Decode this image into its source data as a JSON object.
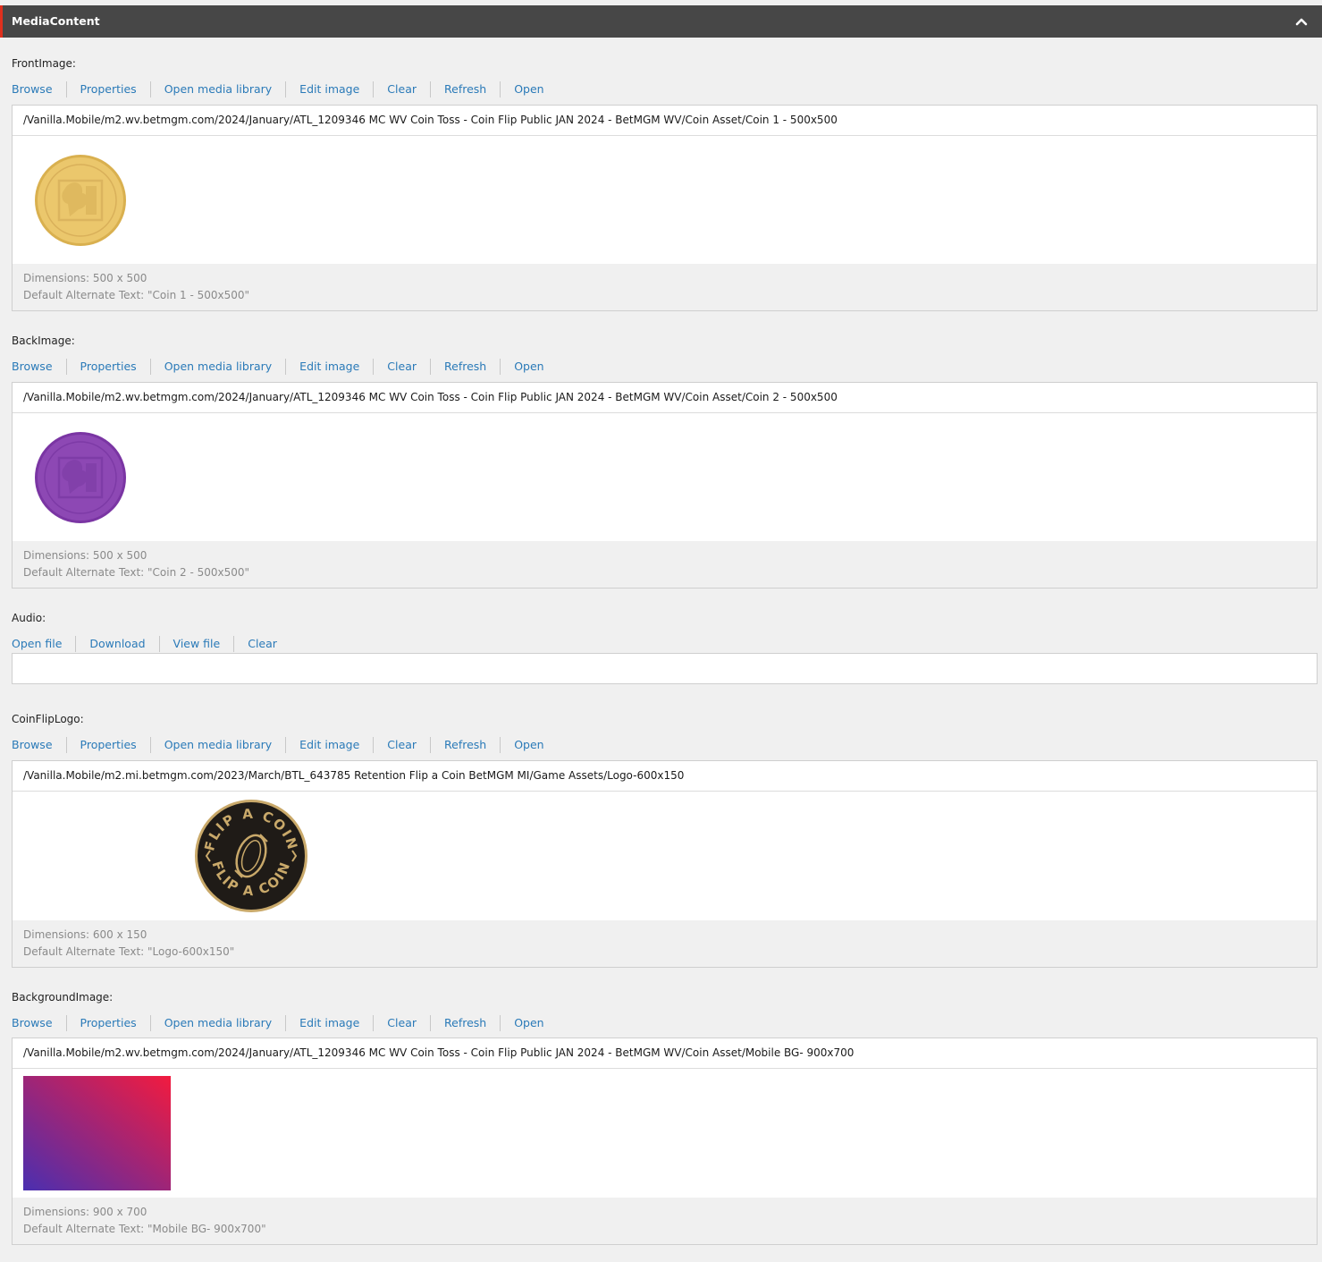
{
  "header": {
    "title": "MediaContent",
    "collapse_icon": "chevron-up-icon"
  },
  "image_actions": [
    "Browse",
    "Properties",
    "Open media library",
    "Edit image",
    "Clear",
    "Refresh",
    "Open"
  ],
  "audio_actions": [
    "Open file",
    "Download",
    "View file",
    "Clear"
  ],
  "front_image": {
    "label": "FrontImage:",
    "path": "/Vanilla.Mobile/m2.wv.betmgm.com/2024/January/ATL_1209346 MC WV Coin Toss - Coin Flip Public JAN 2024 - BetMGM WV/Coin Asset/Coin 1 - 500x500",
    "dimensions": "Dimensions: 500 x 500",
    "alt_text": "Default Alternate Text: \"Coin 1 - 500x500\"",
    "thumbnail": "gold-coin-image",
    "color": "#e8c46a"
  },
  "back_image": {
    "label": "BackImage:",
    "path": "/Vanilla.Mobile/m2.wv.betmgm.com/2024/January/ATL_1209346 MC WV Coin Toss - Coin Flip Public JAN 2024 - BetMGM WV/Coin Asset/Coin 2 - 500x500",
    "dimensions": "Dimensions: 500 x 500",
    "alt_text": "Default Alternate Text: \"Coin 2 - 500x500\"",
    "thumbnail": "purple-coin-image",
    "color": "#8a45b0"
  },
  "audio": {
    "label": "Audio:",
    "value": ""
  },
  "coin_flip_logo": {
    "label": "CoinFlipLogo:",
    "path": "/Vanilla.Mobile/m2.mi.betmgm.com/2023/March/BTL_643785 Retention Flip a Coin BetMGM MI/Game Assets/Logo-600x150",
    "dimensions": "Dimensions: 600 x 150",
    "alt_text": "Default Alternate Text: \"Logo-600x150\"",
    "thumbnail": "flip-a-coin-logo",
    "logo_text": "FLIP A COIN",
    "color": "#c9a96a"
  },
  "background_image": {
    "label": "BackgroundImage:",
    "path": "/Vanilla.Mobile/m2.wv.betmgm.com/2024/January/ATL_1209346 MC WV Coin Toss - Coin Flip Public JAN 2024 - BetMGM WV/Coin Asset/Mobile BG- 900x700",
    "dimensions": "Dimensions: 900 x 700",
    "alt_text": "Default Alternate Text: \"Mobile BG- 900x700\"",
    "thumbnail": "gradient-background-image",
    "gradient_from": "#4a2fb0",
    "gradient_to": "#f21b3f"
  }
}
